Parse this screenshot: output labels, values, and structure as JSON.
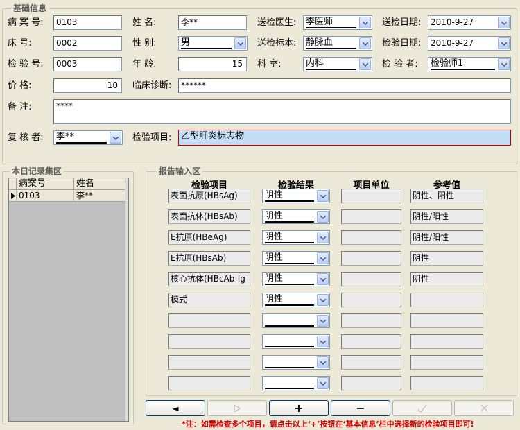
{
  "basic": {
    "title": "基础信息",
    "case_no_label": "病 案 号:",
    "case_no": "0103",
    "name_label": "姓    名:",
    "name": "李**",
    "doctor_label": "送检医生:",
    "doctor": "李医师",
    "send_date_label": "送检日期:",
    "send_date": "2010-9-27",
    "bed_label": "床    号:",
    "bed": "0002",
    "gender_label": "性    别:",
    "gender": "男",
    "specimen_label": "送检标本:",
    "specimen": "静脉血",
    "test_date_label": "检验日期:",
    "test_date": "2010-9-27",
    "test_no_label": "检 验 号:",
    "test_no": "0003",
    "age_label": "年    龄:",
    "age": "15",
    "dept_label": "科    室:",
    "dept": "内科",
    "inspector_label": "检 验 者:",
    "inspector": "检验师1",
    "price_label": "价    格:",
    "price": "10",
    "diagnosis_label": "临床诊断:",
    "diagnosis": "******",
    "remark_label": "备    注:",
    "remark": "****",
    "reviewer_label": "复 核 者:",
    "reviewer": "李**",
    "item_label": "检验项目:",
    "item": "乙型肝炎标志物"
  },
  "records": {
    "title": "本日记录集区",
    "columns": [
      "病案号",
      "姓名"
    ],
    "rows": [
      [
        "0103",
        "李**"
      ]
    ]
  },
  "report": {
    "title": "报告输入区",
    "columns": [
      "检验项目",
      "检验结果",
      "项目单位",
      "参考值"
    ],
    "rows": [
      {
        "item": "表面抗原(HBsAg)",
        "result": "阴性",
        "unit": "",
        "ref": "阴性、阳性"
      },
      {
        "item": "表面抗体(HBsAb)",
        "result": "阴性",
        "unit": "",
        "ref": "阴性/阳性"
      },
      {
        "item": "E抗原(HBeAg)",
        "result": "阴性",
        "unit": "",
        "ref": "阴性/阳性"
      },
      {
        "item": "E抗原(HBsAb)",
        "result": "阴性",
        "unit": "",
        "ref": "阴性"
      },
      {
        "item": "核心抗体(HBcAb-Ig",
        "result": "阴性",
        "unit": "",
        "ref": "阴性"
      },
      {
        "item": "模式",
        "result": "阴性",
        "unit": "",
        "ref": ""
      },
      {
        "item": "",
        "result": "",
        "unit": "",
        "ref": ""
      },
      {
        "item": "",
        "result": "",
        "unit": "",
        "ref": ""
      },
      {
        "item": "",
        "result": "",
        "unit": "",
        "ref": ""
      },
      {
        "item": "",
        "result": "",
        "unit": "",
        "ref": ""
      }
    ]
  },
  "nav": {
    "prev": "◄",
    "add": "+",
    "remove": "−"
  },
  "note": "*注：如需检查多个项目，请点击以上‘+’按钮在‘基本信息’栏中选择新的检验项目即可!"
}
